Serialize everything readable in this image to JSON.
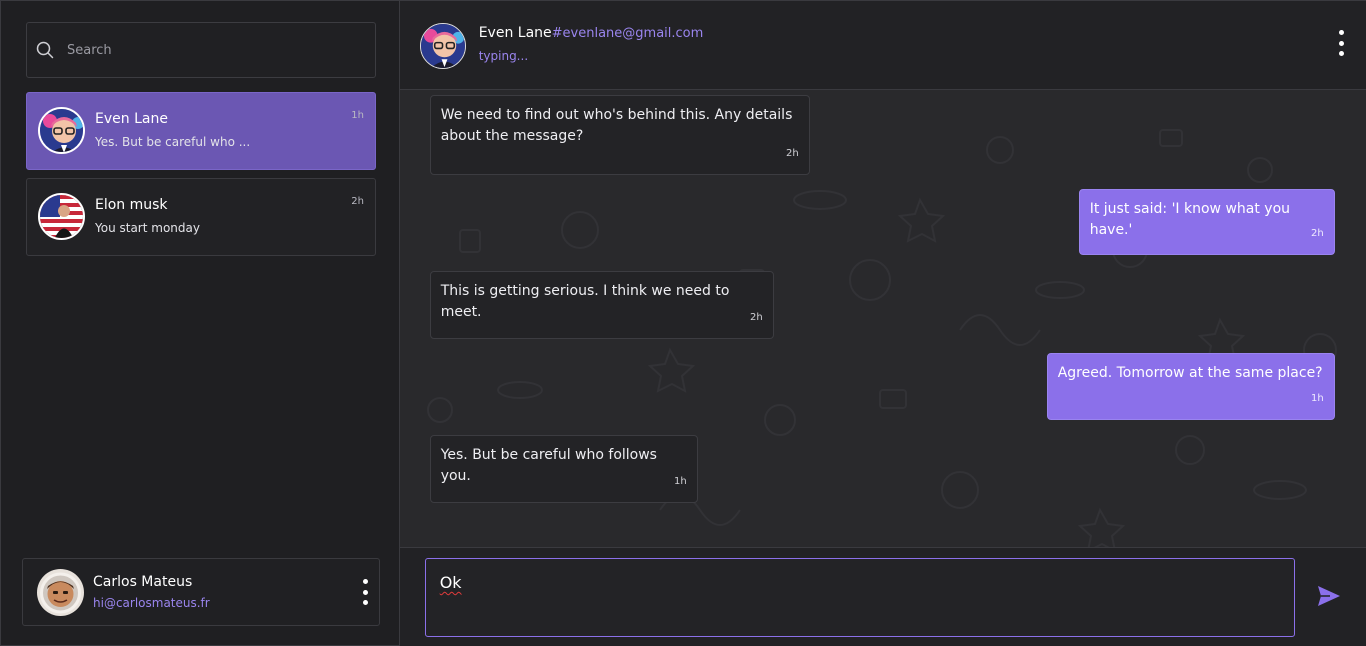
{
  "search": {
    "placeholder": "Search"
  },
  "conversations": [
    {
      "name": "Even Lane",
      "preview": "Yes. But be careful who ...",
      "time": "1h",
      "active": true
    },
    {
      "name": "Elon musk",
      "preview": "You start monday",
      "time": "2h",
      "active": false
    }
  ],
  "current_user": {
    "name": "Carlos Mateus",
    "email": "hi@carlosmateus.fr"
  },
  "chat": {
    "contact_name": "Even Lane",
    "contact_handle": "#evenlane@gmail.com",
    "status": "typing...",
    "messages": [
      {
        "direction": "in",
        "text": "We need to find out who's behind this. Any details about the message?",
        "time": "2h"
      },
      {
        "direction": "out",
        "text": "It just said: 'I know what you have.'",
        "time": "2h"
      },
      {
        "direction": "in",
        "text": "This is getting serious. I think we need to meet.",
        "time": "2h"
      },
      {
        "direction": "out",
        "text": "Agreed. Tomorrow at the same place?",
        "time": "1h"
      },
      {
        "direction": "in",
        "text": "Yes. But be careful who follows you.",
        "time": "1h"
      }
    ]
  },
  "composer": {
    "value": "Ok"
  },
  "icons": {
    "search": "search-icon",
    "menu": "kebab-menu-icon",
    "send": "send-icon"
  },
  "colors": {
    "accent": "#8b70ea",
    "active_conversation": "#6b57b3",
    "background": "#1c1c1e"
  }
}
